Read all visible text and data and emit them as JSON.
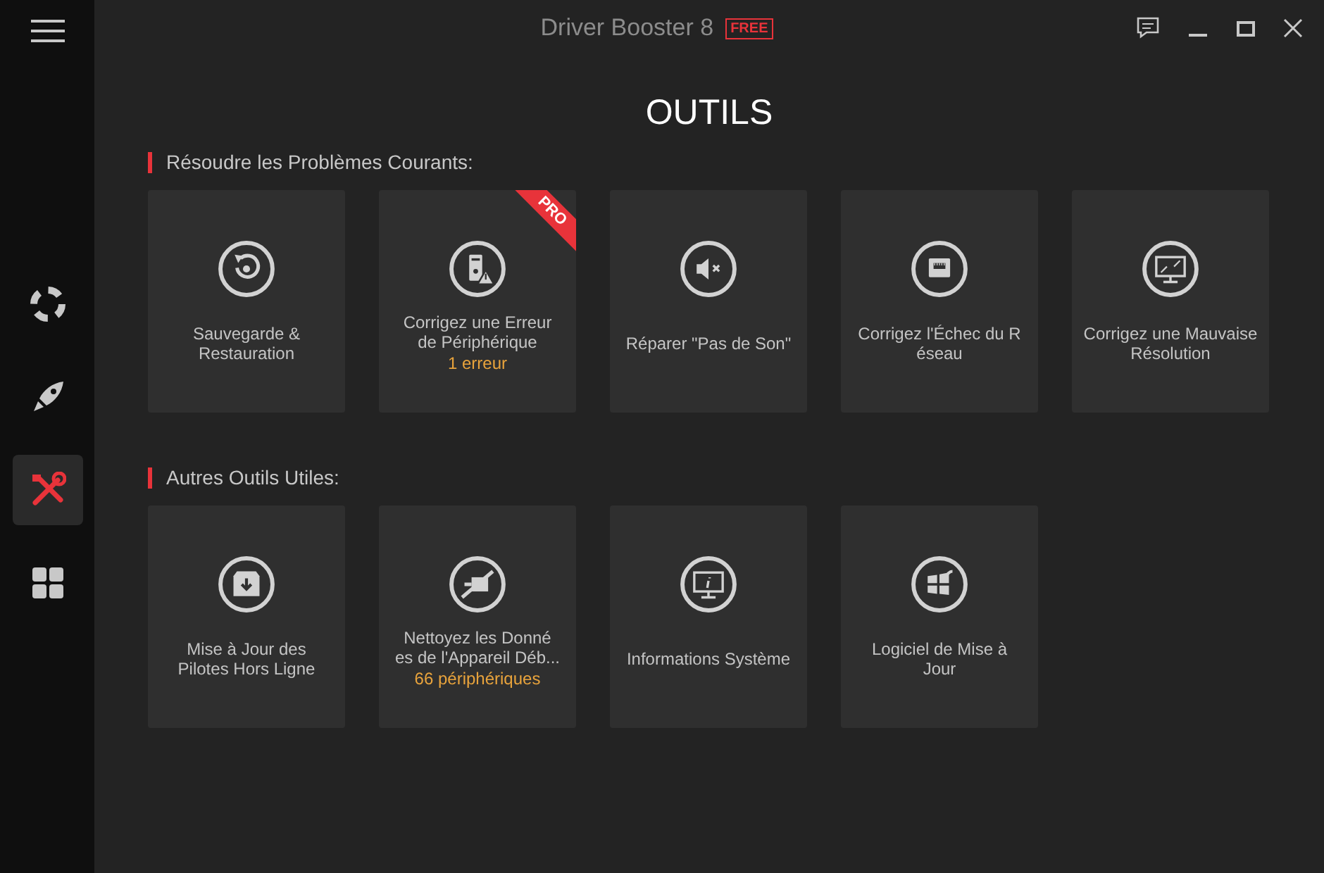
{
  "window": {
    "title": "Driver Booster 8",
    "edition": "FREE"
  },
  "sidebar": {
    "items": [
      {
        "kind": "lifebuoy",
        "selected": false
      },
      {
        "kind": "rocket",
        "selected": false
      },
      {
        "kind": "tools",
        "selected": true
      },
      {
        "kind": "grid",
        "selected": false
      }
    ]
  },
  "page_title": "OUTILS",
  "sections": [
    {
      "heading": "Résoudre les Problèmes Courants:",
      "cards": [
        {
          "kind": "restore",
          "lines": [
            "Sauvegarde &",
            "Restauration"
          ]
        },
        {
          "kind": "device-error",
          "lines": [
            "Corrigez une Erreur",
            "de Périphérique"
          ],
          "status": "1 erreur",
          "badge": "PRO"
        },
        {
          "kind": "no-sound",
          "lines": [
            "Réparer \"Pas de Son\""
          ]
        },
        {
          "kind": "network",
          "lines": [
            "Corrigez l'Échec du R",
            "éseau"
          ]
        },
        {
          "kind": "resolution",
          "lines": [
            "Corrigez une Mauvaise",
            "Résolution"
          ]
        }
      ]
    },
    {
      "heading": "Autres Outils Utiles:",
      "cards": [
        {
          "kind": "offline-update",
          "lines": [
            "Mise à Jour des",
            "Pilotes Hors Ligne"
          ]
        },
        {
          "kind": "clean",
          "lines": [
            "Nettoyez  les Donné",
            "es de l'Appareil Déb..."
          ],
          "status": "66 périphériques"
        },
        {
          "kind": "system-info",
          "lines": [
            "Informations Système"
          ]
        },
        {
          "kind": "software-update",
          "lines": [
            "Logiciel de Mise à",
            "Jour"
          ]
        }
      ]
    }
  ]
}
